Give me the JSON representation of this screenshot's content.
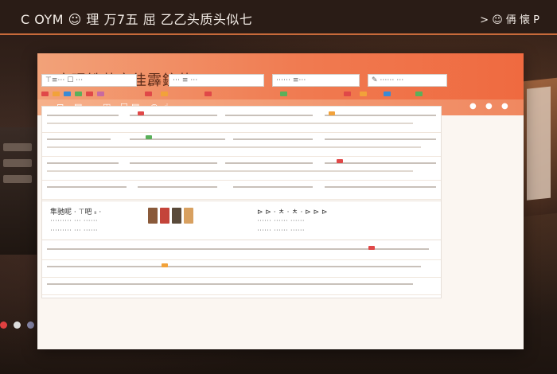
{
  "top_bar": {
    "title": "C OYM ☺ 理 万7五  屈  乙乙头质头似七",
    "breadcrumb": "> ☺ 侢 懐 P"
  },
  "window": {
    "app_title": "宸珉铁芾文徍霹鋎茳",
    "nav": [
      "⊡",
      "▤",
      "◫",
      "☐",
      "▤",
      "◷",
      "☝"
    ],
    "nav_right": [
      "●",
      "●",
      "●"
    ]
  },
  "toolbar": {
    "fields": [
      "⊤≡⋯ ☐ ⋯",
      "⋯ ≡ ⋯",
      "⋯⋯ ≡⋯",
      "✎ ⋯⋯ ⋯"
    ]
  },
  "feature": {
    "left_lines": [
      "隼驰呢 ·  ⊤吧 ᵢᵢ ·",
      "⋯⋯⋯ ⋯ ⋯⋯",
      "⋯⋯⋯ ⋯ ⋯⋯"
    ],
    "right_lines": [
      "⊳ ⊳ ·  ㅊ ·  ㅊ ·  ⊳ ⊳ ⊳",
      "⋯⋯ ⋯⋯ ⋯⋯",
      "⋯⋯ ⋯⋯ ⋯⋯"
    ]
  },
  "colors": {
    "accent": "#ef6a40",
    "header_start": "#f2a279",
    "border": "#c86a3a"
  },
  "icons": [
    "gear-icon",
    "chevron-right-icon",
    "close-icon"
  ]
}
